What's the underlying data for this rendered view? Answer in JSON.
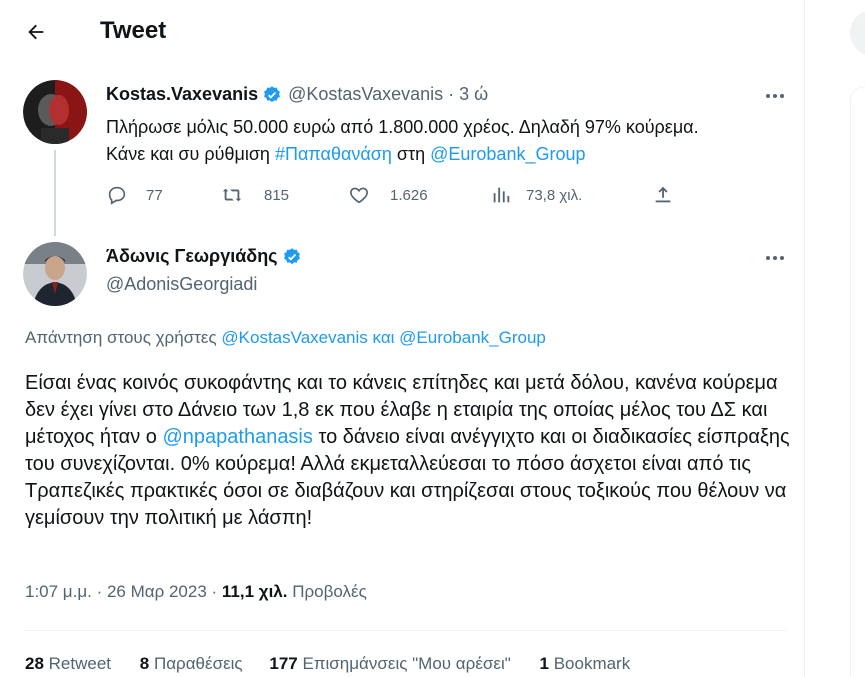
{
  "header": {
    "title": "Tweet",
    "back_icon": "back-arrow-icon"
  },
  "original": {
    "name": "Kostas.Vaxevanis",
    "handle": "@KostasVaxevanis",
    "time": "· 3 ώ",
    "text_1": "Πλήρωσε μόλις 50.000 ευρώ από 1.800.000 χρέος. Δηλαδή 97% κούρεμα.",
    "text_2_pre": "Κάνε και συ ρύθμιση ",
    "hashtag": "#Παπαθανάση",
    "text_2_mid": " στη ",
    "mention": "@Eurobank_Group",
    "actions": {
      "replies": "77",
      "retweets": "815",
      "likes": "1.626",
      "views": "73,8 χιλ."
    }
  },
  "reply": {
    "name": "Άδωνις Γεωργιάδης",
    "handle": "@AdonisGeorgiadi",
    "replying_prefix": "Απάντηση στους χρήστες ",
    "replying_user1": "@KostasVaxevanis",
    "replying_joiner": " και ",
    "replying_user2": "@Eurobank_Group",
    "body_pre": "Είσαι ένας κοινός συκοφάντης και το κάνεις επίτηδες και μετά δόλου, κανένα κούρεμα δεν έχει γίνει στο Δάνειο των 1,8 εκ που έλαβε η εταιρία της οποίας μέλος του ΔΣ και μέτοχος ήταν ο ",
    "body_mention": "@npapathanasis",
    "body_post": " το δάνειο είναι ανέγγιχτο και οι διαδικασίες είσπραξης του συνεχίζονται. 0% κούρεμα! Αλλά εκμεταλλεύεσαι το πόσο άσχετοι είναι από τις Τραπεζικές πρακτικές όσοι σε διαβάζουν και στηρίζεσαι στους τοξικούς που θέλουν να γεμίσουν την πολιτική με λάσπη!",
    "timestamp": "1:07 μ.μ. · 26 Μαρ 2023 · ",
    "views_count": "11,1 χιλ.",
    "views_label": " Προβολές",
    "stats": [
      {
        "count": "28",
        "label": " Retweet"
      },
      {
        "count": "8",
        "label": " Παραθέσεις"
      },
      {
        "count": "177",
        "label": " Επισημάνσεις \"Μου αρέσει\""
      },
      {
        "count": "1",
        "label": " Bookmark"
      }
    ]
  },
  "colors": {
    "accent": "#1d9bf0",
    "text": "#0f1419",
    "muted": "#536471"
  }
}
